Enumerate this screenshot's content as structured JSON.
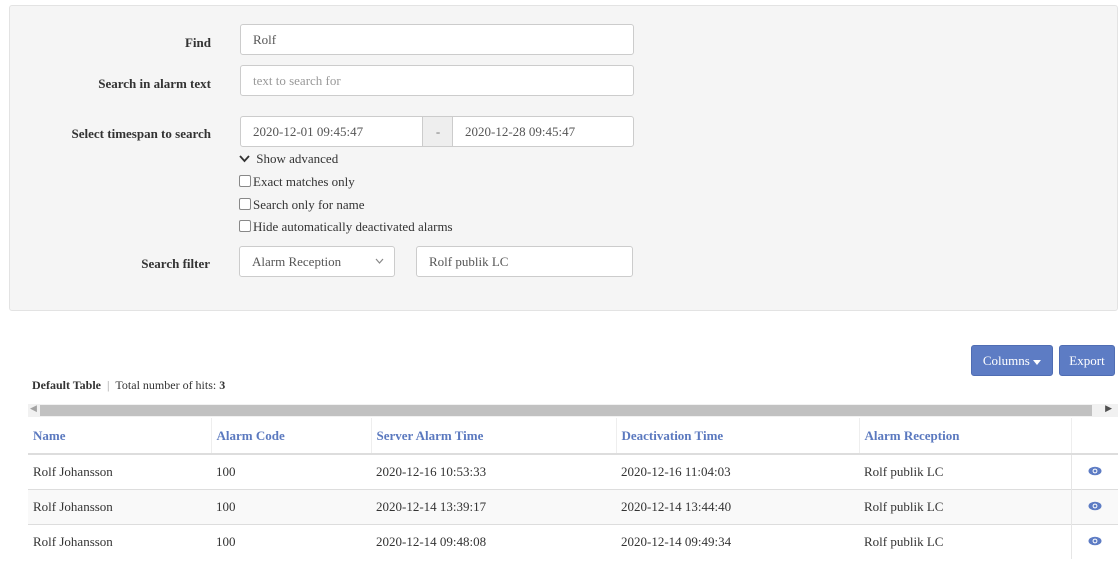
{
  "search": {
    "find_label": "Find",
    "find_value": "Rolf",
    "alarm_text_label": "Search in alarm text",
    "alarm_text_placeholder": "text to search for",
    "timespan_label": "Select timespan to search",
    "date_from": "2020-12-01 09:45:47",
    "date_separator": "-",
    "date_to": "2020-12-28 09:45:47",
    "show_advanced": "Show advanced",
    "exact_matches": "Exact matches only",
    "name_only": "Search only for name",
    "hide_deactivated": "Hide automatically deactivated alarms",
    "filter_label": "Search filter",
    "filter_select": "Alarm Reception",
    "filter_value": "Rolf publik LC"
  },
  "toolbar": {
    "columns_label": "Columns",
    "export_label": "Export"
  },
  "table": {
    "name": "Default Table",
    "separator": "|",
    "hits_label": "Total number of hits:",
    "hits_count": "3",
    "headers": [
      "Name",
      "Alarm Code",
      "Server Alarm Time",
      "Deactivation Time",
      "Alarm Reception"
    ],
    "rows": [
      [
        "Rolf Johansson",
        "100",
        "2020-12-16 10:53:33",
        "2020-12-16 11:04:03",
        "Rolf publik LC"
      ],
      [
        "Rolf Johansson",
        "100",
        "2020-12-14 13:39:17",
        "2020-12-14 13:44:40",
        "Rolf publik LC"
      ],
      [
        "Rolf Johansson",
        "100",
        "2020-12-14 09:48:08",
        "2020-12-14 09:49:34",
        "Rolf publik LC"
      ]
    ]
  },
  "icons": {
    "row_action": "eye-icon",
    "advanced_toggle": "chevron-down-icon",
    "columns_caret": "caret-down-icon"
  },
  "colors": {
    "accent": "#5d7cc4",
    "header_text": "#5b79bf"
  }
}
